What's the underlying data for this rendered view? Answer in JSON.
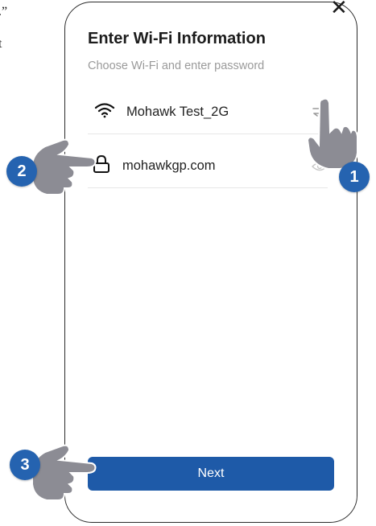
{
  "background": {
    "snippet_quote": ".”",
    "snippet_t": "t"
  },
  "dialog": {
    "close_glyph": "✕",
    "title": "Enter Wi-Fi Information",
    "subtitle": "Choose Wi-Fi and enter password",
    "wifi_row": {
      "icon": "wifi-icon",
      "network_name": "Mohawk Test_2G",
      "action_icon": "switch-network-icon"
    },
    "password_row": {
      "icon": "lock-icon",
      "password_value": "mohawkgp.com",
      "action_icon": "eye-icon"
    },
    "next_label": "Next"
  },
  "callouts": [
    {
      "number": "1",
      "icon": "pointing-hand-icon"
    },
    {
      "number": "2",
      "icon": "pointing-hand-icon"
    },
    {
      "number": "3",
      "icon": "pointing-hand-icon"
    }
  ],
  "colors": {
    "accent": "#1e5aa8",
    "badge": "#2563b0",
    "hand": "#8c8c94",
    "subtitle": "#9a9a9a"
  }
}
